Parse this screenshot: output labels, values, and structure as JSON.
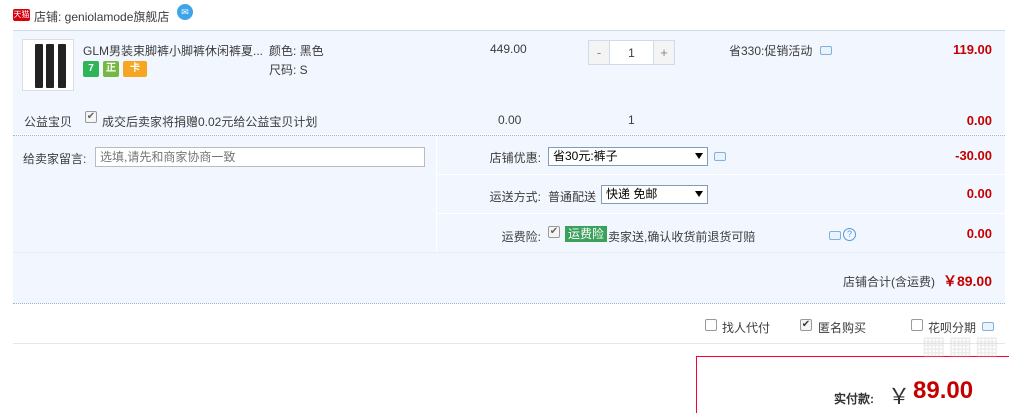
{
  "store": {
    "badge": "天猫",
    "label": "店铺: geniolamode旗舰店",
    "ww_icon": "ww-chat-icon"
  },
  "item": {
    "title": "GLM男装束脚裤小脚裤休闲裤夏...",
    "color_label": "颜色: 黑色",
    "size_label": "尺码: S",
    "price": "449.00",
    "quantity": "1",
    "minus": "-",
    "plus": "+",
    "promo": "省330:促销活动",
    "subtotal": "119.00",
    "service_icons": [
      "seven-day-return-icon",
      "genuine-guarantee-icon",
      "credit-card-icon"
    ],
    "service_glyphs": [
      "7",
      "正",
      "卡"
    ]
  },
  "charity": {
    "label": "公益宝贝",
    "text": "成交后卖家将捐赠0.02元给公益宝贝计划",
    "price": "0.00",
    "quantity": "1",
    "subtotal": "0.00"
  },
  "remark": {
    "label": "给卖家留言:",
    "placeholder": "选填,请先和商家协商一致"
  },
  "discount": {
    "label": "店铺优惠:",
    "selected": "省30元:裤子",
    "amount": "-30.00"
  },
  "shipping": {
    "label": "运送方式:",
    "method": "普通配送",
    "selected": "快递 免邮",
    "amount": "0.00"
  },
  "insurance": {
    "label": "运费险:",
    "badge": "运费险",
    "text": "卖家送,确认收货前退货可赔",
    "amount": "0.00"
  },
  "store_total": {
    "label": "店铺合计(含运费)",
    "amount": "￥89.00"
  },
  "extras": {
    "proxy_pay": "找人代付",
    "anonymous": "匿名购买",
    "installment": "花呗分期"
  },
  "pay": {
    "label": "实付款:",
    "currency": "￥",
    "amount": "89.00"
  },
  "colors": {
    "accent": "#c40000",
    "panel": "#f2f7ff",
    "pay_border": "#ff0036"
  }
}
